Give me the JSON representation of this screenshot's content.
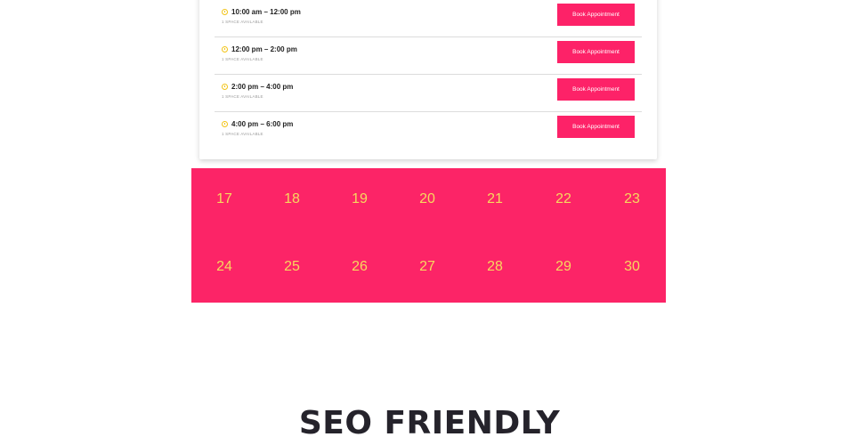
{
  "slots": [
    {
      "time": "10:00 am – 12:00 pm",
      "availability": "1 SPACE AVAILABLE",
      "button": "Book Appointment"
    },
    {
      "time": "12:00 pm – 2:00 pm",
      "availability": "1 SPACE AVAILABLE",
      "button": "Book Appointment"
    },
    {
      "time": "2:00 pm – 4:00 pm",
      "availability": "1 SPACE AVAILABLE",
      "button": "Book Appointment"
    },
    {
      "time": "4:00 pm – 6:00 pm",
      "availability": "1 SPACE AVAILABLE",
      "button": "Book Appointment"
    }
  ],
  "calendar": {
    "weeks": [
      [
        "17",
        "18",
        "19",
        "20",
        "21",
        "22",
        "23"
      ],
      [
        "24",
        "25",
        "26",
        "27",
        "28",
        "29",
        "30"
      ]
    ],
    "background_color": "#fc2467",
    "day_color": "#f7d85e"
  },
  "section": {
    "heading": "SEO FRIENDLY"
  },
  "colors": {
    "button": "#fd2268",
    "clock_icon": "#f2c418"
  },
  "icons": {
    "slot_icon": "clock-icon"
  }
}
